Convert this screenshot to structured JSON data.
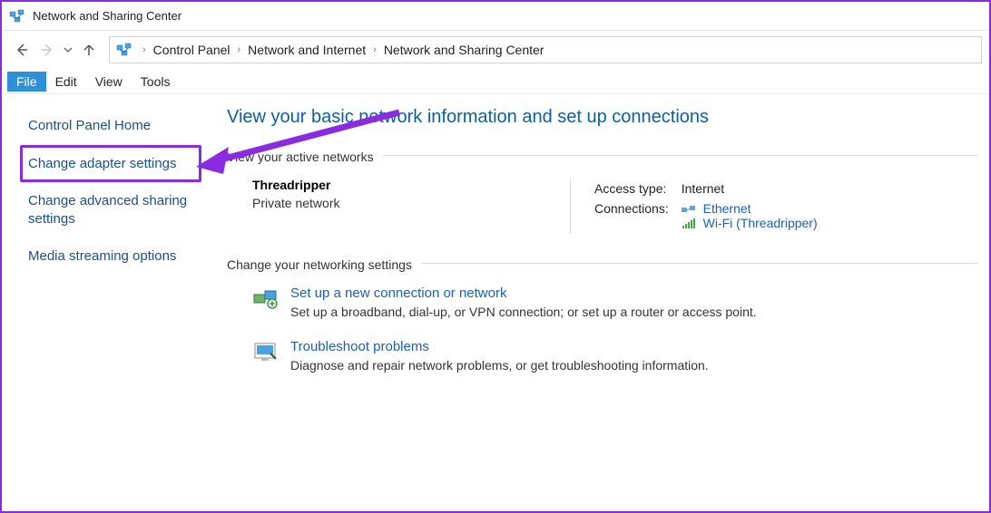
{
  "titlebar": {
    "title": "Network and Sharing Center"
  },
  "breadcrumb": {
    "items": [
      "Control Panel",
      "Network and Internet",
      "Network and Sharing Center"
    ]
  },
  "menu": {
    "file": "File",
    "edit": "Edit",
    "view": "View",
    "tools": "Tools"
  },
  "sidebar": {
    "home": "Control Panel Home",
    "adapter": "Change adapter settings",
    "advanced": "Change advanced sharing settings",
    "streaming": "Media streaming options"
  },
  "main": {
    "heading": "View your basic network information and set up connections",
    "active_section": "View your active networks",
    "network": {
      "name": "Threadripper",
      "type": "Private network",
      "access_label": "Access type:",
      "access_value": "Internet",
      "connections_label": "Connections:",
      "conn_ethernet": "Ethernet",
      "conn_wifi": "Wi-Fi (Threadripper)"
    },
    "change_section": "Change your networking settings",
    "setup": {
      "title": "Set up a new connection or network",
      "desc": "Set up a broadband, dial-up, or VPN connection; or set up a router or access point."
    },
    "troubleshoot": {
      "title": "Troubleshoot problems",
      "desc": "Diagnose and repair network problems, or get troubleshooting information."
    }
  },
  "colors": {
    "highlight": "#8a2be2",
    "link": "#1a5fbb",
    "heading": "#0a5fa5"
  }
}
